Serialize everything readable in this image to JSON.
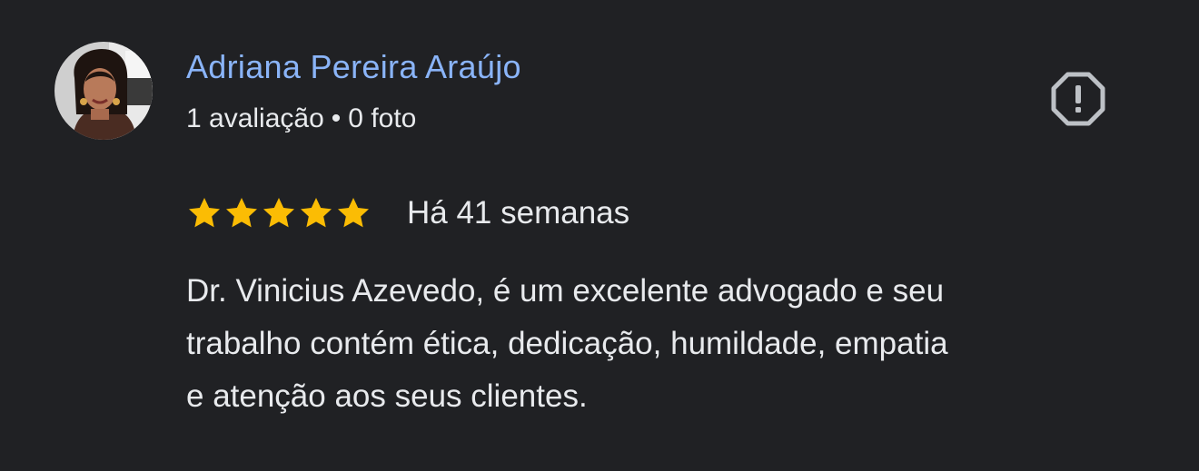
{
  "review": {
    "author": {
      "name": "Adriana Pereira Araújo",
      "review_count": "1 avaliação",
      "separator": "•",
      "photo_count": "0 foto",
      "avatar": "user-profile-photo"
    },
    "rating": {
      "stars": 5,
      "max": 5,
      "star_color": "#fbbc04"
    },
    "date": "Há 41 semanas",
    "text_lines": [
      "Dr. Vinicius Azevedo, é um excelente advogado e seu",
      "trabalho contém ética, dedicação, humildade, empatia",
      "e atenção aos seus clientes."
    ],
    "actions": {
      "flag_icon": "report-flag-icon"
    }
  },
  "colors": {
    "background": "#202124",
    "name": "#8ab4f8",
    "text": "#e8eaed",
    "icon": "#bdc1c6"
  }
}
